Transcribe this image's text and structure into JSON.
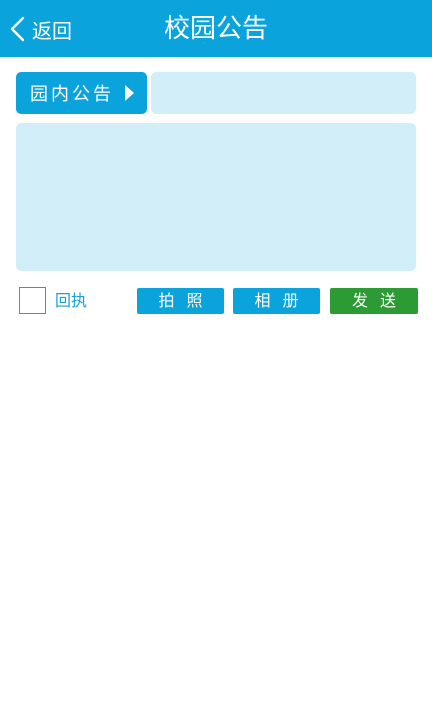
{
  "header": {
    "back_label": "返回",
    "title": "校园公告"
  },
  "form": {
    "category_label": "园内公告",
    "title_placeholder": "",
    "content_placeholder": ""
  },
  "actions": {
    "receipt_label": "回执",
    "receipt_checked": false,
    "photo_label": "拍照",
    "album_label": "相册",
    "send_label": "发送"
  },
  "colors": {
    "primary": "#0ba3dc",
    "input_bg": "#d2eef9",
    "send": "#2c9b34",
    "receipt_text": "#1a9fd8"
  }
}
